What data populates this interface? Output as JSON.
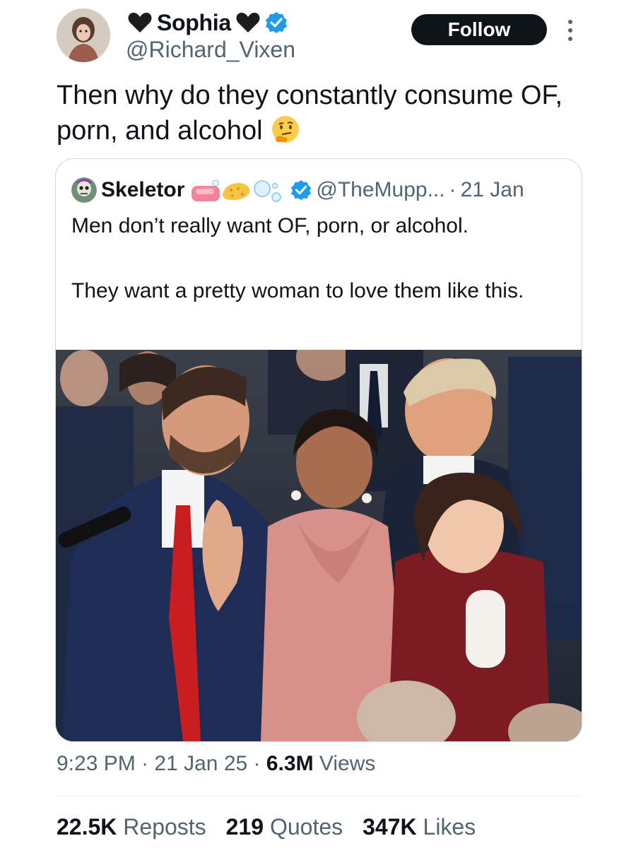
{
  "author": {
    "display_name": "Sophia",
    "handle": "@Richard_Vixen",
    "verified": true,
    "name_decoration_icon": "black-heart-icon"
  },
  "follow_button": {
    "label": "Follow"
  },
  "tweet": {
    "text": "Then why do they constantly consume OF, porn, and alcohol",
    "trailing_emoji": "thinking-face-emoji"
  },
  "quoted_tweet": {
    "display_name": "Skeletor",
    "name_emojis": [
      "soap-emoji",
      "sponge-emoji",
      "bubbles-emoji"
    ],
    "verified": true,
    "handle": "@TheMupp...",
    "separator": "·",
    "date": "21 Jan",
    "text": "Men don’t really want OF, porn, or alcohol.\n\nThey want a pretty woman to love them like this.",
    "media_description": "photo"
  },
  "meta": {
    "time": "9:23 PM",
    "sep1": " · ",
    "date": "21 Jan 25",
    "sep2": " · ",
    "views_count": "6.3M",
    "views_label": " Views"
  },
  "stats": {
    "reposts_count": "22.5K",
    "reposts_label": "Reposts",
    "quotes_count": "219",
    "quotes_label": "Quotes",
    "likes_count": "347K",
    "likes_label": "Likes"
  },
  "colors": {
    "text": "#0f1419",
    "secondary": "#536471",
    "verified": "#1d9bf0",
    "follow_bg": "#0f1419",
    "border": "#cfd9de"
  }
}
